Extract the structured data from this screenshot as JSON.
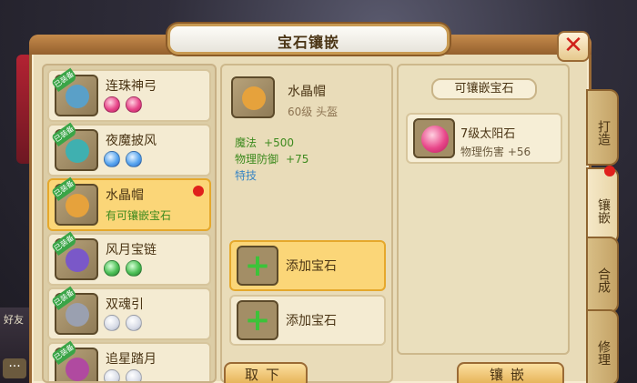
{
  "title": "宝石镶嵌",
  "close_label": "✕",
  "background": {
    "friend_label": "好友",
    "chat_label": "···"
  },
  "equipment": [
    {
      "name": "连珠神弓",
      "tag": "已装备",
      "gems": [
        "red",
        "red"
      ],
      "thumb": "#5aa0c8"
    },
    {
      "name": "夜魔披风",
      "tag": "已装备",
      "gems": [
        "blue",
        "blue"
      ],
      "thumb": "#3fb0b0"
    },
    {
      "name": "水晶帽",
      "tag": "已装备",
      "subtitle": "有可镶嵌宝石",
      "selected": true,
      "thumb": "#e6a23c"
    },
    {
      "name": "风月宝链",
      "tag": "已装备",
      "gems": [
        "green",
        "green"
      ],
      "thumb": "#7a58c8"
    },
    {
      "name": "双魂引",
      "tag": "已装备",
      "gems": [
        "white",
        "white"
      ],
      "thumb": "#9aa0b0"
    },
    {
      "name": "追星踏月",
      "tag": "已装备",
      "gems": [
        "white",
        "white"
      ],
      "thumb": "#b04aa0"
    }
  ],
  "detail": {
    "name": "水晶帽",
    "level": "60级 头盔",
    "stats": [
      {
        "label": "魔法",
        "value": "+500"
      },
      {
        "label": "物理防御",
        "value": "+75"
      }
    ],
    "special": "特技",
    "add_slots": [
      "添加宝石",
      "添加宝石"
    ]
  },
  "available": {
    "header": "可镶嵌宝石",
    "gem": {
      "name": "7级太阳石",
      "stat": "物理伤害 +56"
    }
  },
  "tabs": [
    "打造",
    "镶嵌",
    "合成",
    "修理"
  ],
  "buttons": {
    "remove": "取下",
    "inlay": "镶嵌"
  }
}
